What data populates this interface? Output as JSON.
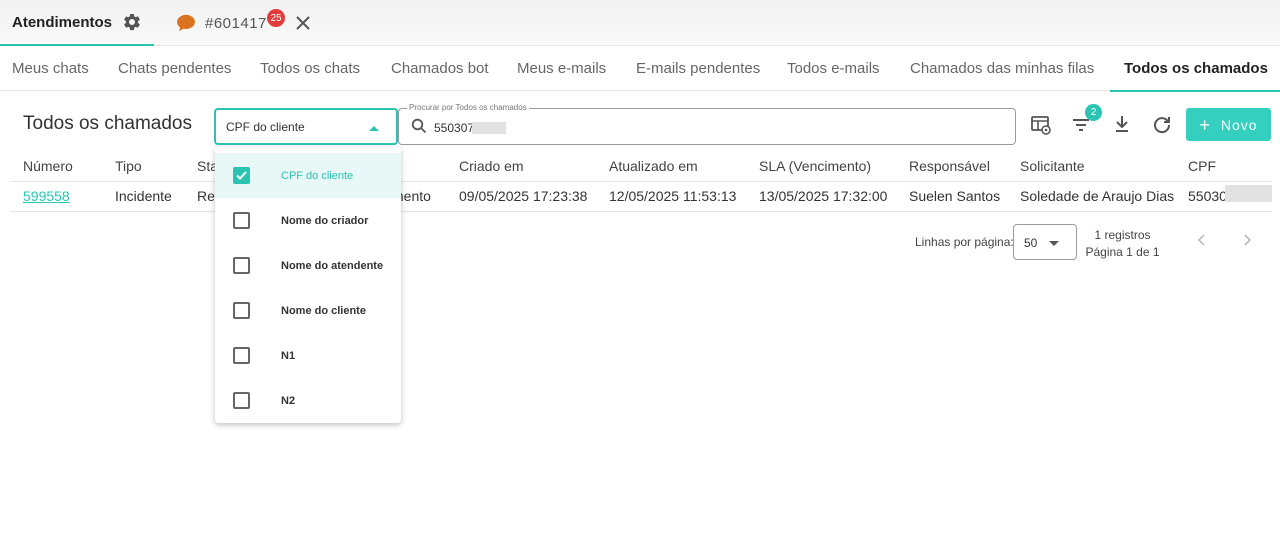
{
  "topbar": {
    "main_tab_label": "Atendimentos",
    "chat_tab_id": "#601417",
    "chat_badge": "25"
  },
  "nav_tabs": [
    {
      "label": "Meus chats",
      "active": false
    },
    {
      "label": "Chats pendentes",
      "active": false
    },
    {
      "label": "Todos os chats",
      "active": false
    },
    {
      "label": "Chamados bot",
      "active": false
    },
    {
      "label": "Meus e-mails",
      "active": false
    },
    {
      "label": "E-mails pendentes",
      "active": false
    },
    {
      "label": "Todos e-mails",
      "active": false
    },
    {
      "label": "Chamados das minhas filas",
      "active": false
    },
    {
      "label": "Todos os chamados",
      "active": true
    }
  ],
  "toolbar": {
    "title": "Todos os chamados",
    "filter_select_value": "CPF do cliente",
    "search_legend": "Procurar por Todos os chamados",
    "search_value": "550307",
    "filter_count": "2",
    "new_button_label": "Novo"
  },
  "table": {
    "headers": [
      "Número",
      "Tipo",
      "Sta",
      "Criado em",
      "Atualizado em",
      "SLA (Vencimento)",
      "Responsável",
      "Solicitante",
      "CPF"
    ],
    "rows": [
      {
        "numero": "599558",
        "tipo": "Incidente",
        "status_partial": "Res",
        "partial_hidden": "mento",
        "criado_em": "09/05/2025 17:23:38",
        "atualizado_em": "12/05/2025 11:53:13",
        "sla": "13/05/2025 17:32:00",
        "responsavel": "Suelen Santos",
        "solicitante": "Soledade de Araujo Dias",
        "cpf": "55030"
      }
    ]
  },
  "pagination": {
    "rows_per_page_label": "Linhas por página:",
    "rows_per_page_value": "50",
    "records": "1 registros",
    "page": "Página 1 de 1"
  },
  "dropdown": {
    "items": [
      {
        "label": "CPF do cliente",
        "checked": true
      },
      {
        "label": "Nome do criador",
        "checked": false
      },
      {
        "label": "Nome do atendente",
        "checked": false
      },
      {
        "label": "Nome do cliente",
        "checked": false
      },
      {
        "label": "N1",
        "checked": false
      },
      {
        "label": "N2",
        "checked": false
      }
    ]
  },
  "colors": {
    "accent": "#2bc4b3",
    "badge": "#e23b3b",
    "chat_icon": "#d9731f"
  },
  "icons": [
    "gear-icon",
    "chat-bubble-icon",
    "close-icon",
    "search-icon",
    "table-view-icon",
    "filter-icon",
    "download-icon",
    "refresh-icon",
    "plus-icon",
    "chevron-left-icon",
    "chevron-right-icon",
    "check-icon"
  ]
}
